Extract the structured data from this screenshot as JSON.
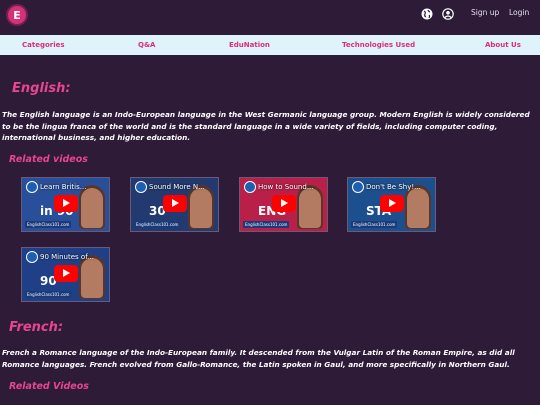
{
  "header": {
    "logo_letter": "E",
    "signup": "Sign up",
    "login": "Login"
  },
  "nav": {
    "categories": "Categories",
    "qa": "Q&A",
    "edunation": "EduNation",
    "technologies": "Technologies Used",
    "about": "About Us"
  },
  "english": {
    "title": "English:",
    "description": "The English language is an Indo-European language in the West Germanic language group. Modern English is widely considered to be the lingua franca of the world and is the standard language in a wide variety of fields, including computer coding, international business, and higher education.",
    "related_label": "Related videos",
    "videos": [
      {
        "title": "Learn Britis...",
        "footer": "EnglishClass101.com",
        "big": "in 90",
        "bg": "#2a4f9a"
      },
      {
        "title": "Sound More N...",
        "footer": "EnglishClass101.com",
        "big": "30",
        "bg": "#223a70"
      },
      {
        "title": "How to Sound...",
        "footer": "EnglishClass101.com",
        "big": "ENG",
        "bg": "#b8204a"
      },
      {
        "title": "Don't Be Shy!...",
        "footer": "EnglishClass101.com",
        "big": "STA",
        "bg": "#1c4f8e"
      },
      {
        "title": "90 Minutes of...",
        "footer": "EnglishClass101.com",
        "big": "90",
        "bg": "#1f3f86"
      }
    ]
  },
  "french": {
    "title": "French:",
    "description": "French a Romance language of the Indo-European family. It descended from the Vulgar Latin of the Roman Empire, as did all Romance languages. French evolved from Gallo-Romance, the Latin spoken in Gaul, and more specifically in Northern Gaul.",
    "related_label": "Related Videos"
  },
  "colors": {
    "background": "#2d1b38",
    "accent": "#e84590",
    "nav_bg": "#dff3fb"
  }
}
